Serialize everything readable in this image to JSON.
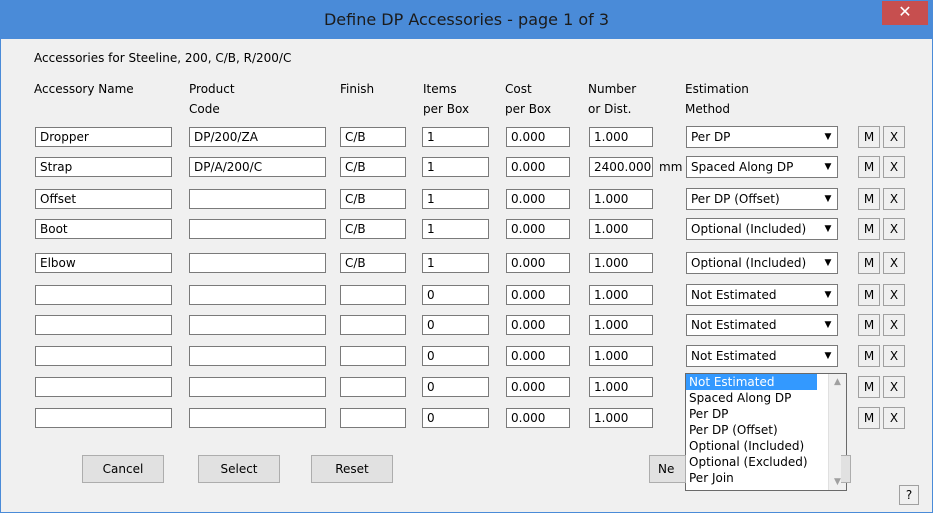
{
  "window": {
    "title": "Define DP Accessories - page 1 of 3",
    "close_label": "✕"
  },
  "subtitle": "Accessories for Steeline, 200, C/B, R/200/C",
  "headers": {
    "name": "Accessory Name",
    "code": "Product\nCode",
    "finish": "Finish",
    "items": "Items\nper Box",
    "cost": "Cost\nper Box",
    "number": "Number\nor Dist.",
    "method": "Estimation\nMethod"
  },
  "rows": [
    {
      "name": "Dropper",
      "code": "DP/200/ZA",
      "finish": "C/B",
      "items": "1",
      "cost": "0.000",
      "number": "1.000",
      "unit": "",
      "method": "Per DP"
    },
    {
      "name": "Strap",
      "code": "DP/A/200/C",
      "finish": "C/B",
      "items": "1",
      "cost": "0.000",
      "number": "2400.000",
      "unit": "mm",
      "method": "Spaced Along DP"
    },
    {
      "name": "Offset",
      "code": "",
      "finish": "C/B",
      "items": "1",
      "cost": "0.000",
      "number": "1.000",
      "unit": "",
      "method": "Per DP (Offset)"
    },
    {
      "name": "Boot",
      "code": "",
      "finish": "C/B",
      "items": "1",
      "cost": "0.000",
      "number": "1.000",
      "unit": "",
      "method": "Optional (Included)"
    },
    {
      "name": "Elbow",
      "code": "",
      "finish": "C/B",
      "items": "1",
      "cost": "0.000",
      "number": "1.000",
      "unit": "",
      "method": "Optional (Included)"
    },
    {
      "name": "",
      "code": "",
      "finish": "",
      "items": "0",
      "cost": "0.000",
      "number": "1.000",
      "unit": "",
      "method": "Not Estimated"
    },
    {
      "name": "",
      "code": "",
      "finish": "",
      "items": "0",
      "cost": "0.000",
      "number": "1.000",
      "unit": "",
      "method": "Not Estimated"
    },
    {
      "name": "",
      "code": "",
      "finish": "",
      "items": "0",
      "cost": "0.000",
      "number": "1.000",
      "unit": "",
      "method": "Not Estimated"
    },
    {
      "name": "",
      "code": "",
      "finish": "",
      "items": "0",
      "cost": "0.000",
      "number": "1.000",
      "unit": "",
      "method": ""
    },
    {
      "name": "",
      "code": "",
      "finish": "",
      "items": "0",
      "cost": "0.000",
      "number": "1.000",
      "unit": "",
      "method": ""
    }
  ],
  "row_buttons": {
    "m_label": "M",
    "x_label": "X"
  },
  "dropdown_options": [
    "Not Estimated",
    "Spaced Along DP",
    "Per DP",
    "Per DP (Offset)",
    "Optional (Included)",
    "Optional (Excluded)",
    "Per Join"
  ],
  "buttons": {
    "cancel": "Cancel",
    "select": "Select",
    "reset": "Reset",
    "next_partial": "Ne",
    "help": "?"
  }
}
